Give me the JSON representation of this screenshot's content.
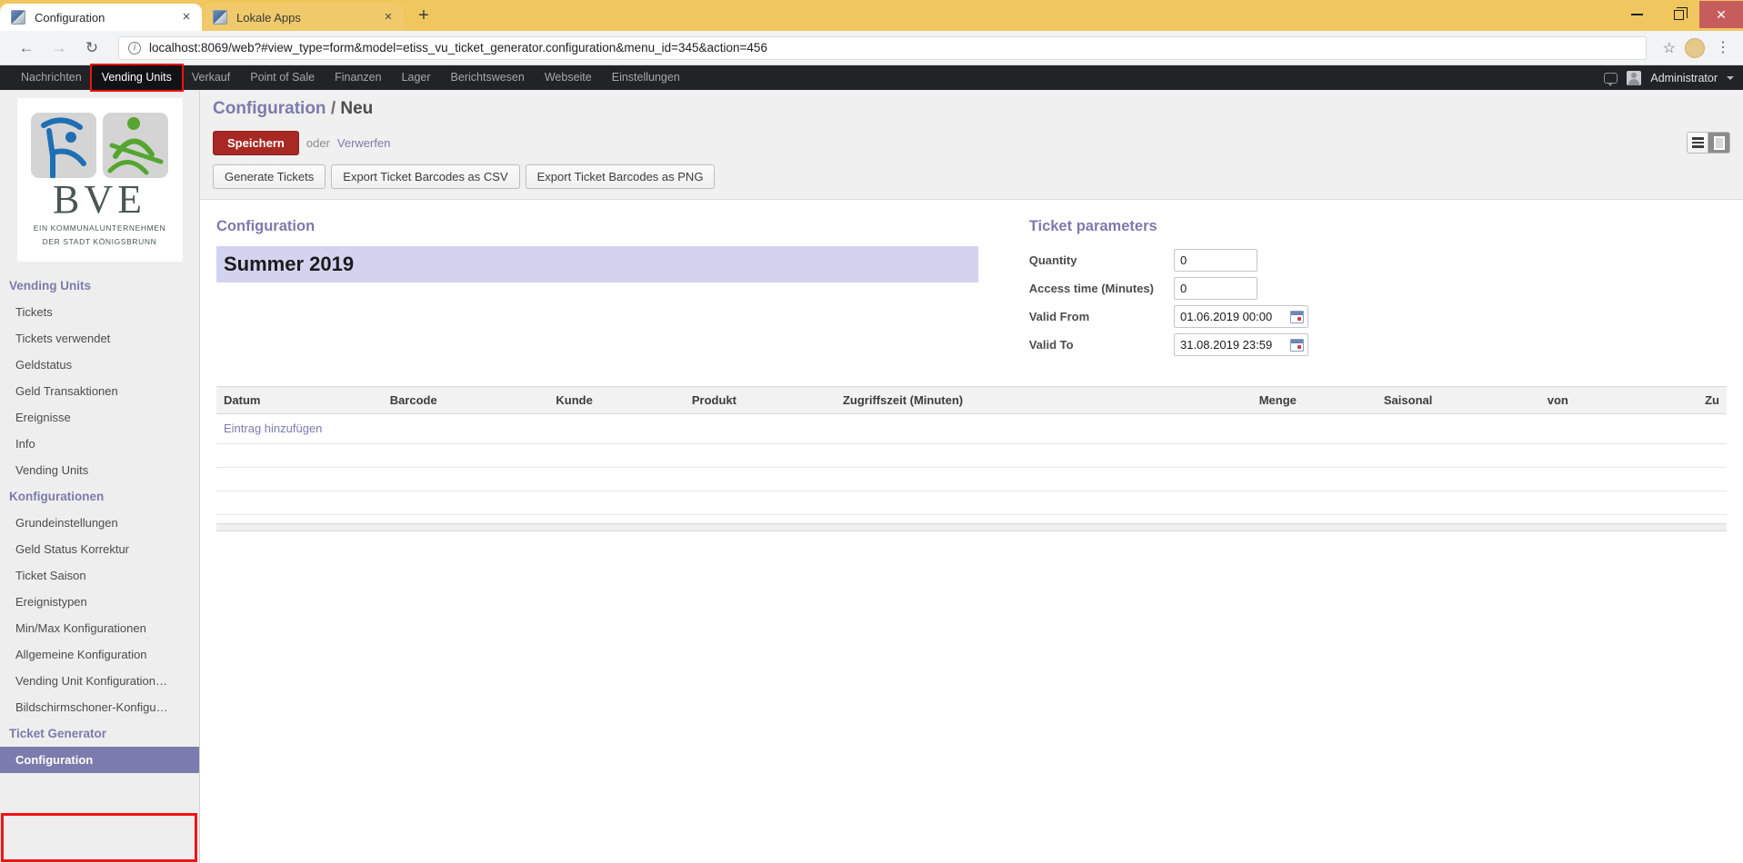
{
  "browser": {
    "tabs": [
      {
        "title": "Configuration",
        "active": true,
        "close_label": "×"
      },
      {
        "title": "Lokale Apps",
        "active": false,
        "close_label": "×"
      }
    ],
    "new_tab_label": "+",
    "window_controls": {
      "minimize": "",
      "maximize": "",
      "close": "✕"
    },
    "nav": {
      "back": "←",
      "forward": "→",
      "reload": "↻"
    },
    "address": "localhost:8069/web?#view_type=form&model=etiss_vu_ticket_generator.configuration&menu_id=345&action=456",
    "info_icon_label": "i",
    "bookmark_label": "☆",
    "menu_label": "⋮"
  },
  "topnav": {
    "items": [
      {
        "label": "Nachrichten",
        "active": false
      },
      {
        "label": "Vending Units",
        "active": true
      },
      {
        "label": "Verkauf",
        "active": false
      },
      {
        "label": "Point of Sale",
        "active": false
      },
      {
        "label": "Finanzen",
        "active": false
      },
      {
        "label": "Lager",
        "active": false
      },
      {
        "label": "Berichtswesen",
        "active": false
      },
      {
        "label": "Webseite",
        "active": false
      },
      {
        "label": "Einstellungen",
        "active": false
      }
    ],
    "user": "Administrator"
  },
  "sidebar": {
    "logo": {
      "wordmark": "BVE",
      "line1": "EIN KOMMUNALUNTERNEHMEN",
      "line2": "DER STADT KÖNIGSBRUNN"
    },
    "sections": [
      {
        "title": "Vending Units",
        "items": [
          {
            "label": "Tickets",
            "selected": false
          },
          {
            "label": "Tickets verwendet",
            "selected": false
          },
          {
            "label": "Geldstatus",
            "selected": false
          },
          {
            "label": "Geld Transaktionen",
            "selected": false
          },
          {
            "label": "Ereignisse",
            "selected": false
          },
          {
            "label": "Info",
            "selected": false
          },
          {
            "label": "Vending Units",
            "selected": false
          }
        ]
      },
      {
        "title": "Konfigurationen",
        "items": [
          {
            "label": "Grundeinstellungen",
            "selected": false
          },
          {
            "label": "Geld Status Korrektur",
            "selected": false
          },
          {
            "label": "Ticket Saison",
            "selected": false
          },
          {
            "label": "Ereignistypen",
            "selected": false
          },
          {
            "label": "Min/Max Konfigurationen",
            "selected": false
          },
          {
            "label": "Allgemeine Konfiguration",
            "selected": false
          },
          {
            "label": "Vending Unit Konfiguration…",
            "selected": false
          },
          {
            "label": "Bildschirmschoner-Konfigu…",
            "selected": false
          }
        ]
      },
      {
        "title": "Ticket Generator",
        "items": [
          {
            "label": "Configuration",
            "selected": true
          }
        ]
      }
    ]
  },
  "control_panel": {
    "breadcrumb_root": "Configuration",
    "breadcrumb_separator": "/",
    "breadcrumb_current": "Neu",
    "save_label": "Speichern",
    "or_label": "oder",
    "discard_label": "Verwerfen",
    "actions": [
      "Generate Tickets",
      "Export Ticket Barcodes as CSV",
      "Export Ticket Barcodes as PNG"
    ],
    "views": [
      {
        "name": "list-view",
        "active": false
      },
      {
        "name": "form-view",
        "active": true
      }
    ]
  },
  "form": {
    "left_section_title": "Configuration",
    "name_value": "Summer 2019",
    "right_section_title": "Ticket parameters",
    "fields": [
      {
        "label": "Quantity",
        "value": "0",
        "type": "number"
      },
      {
        "label": "Access time (Minutes)",
        "value": "0",
        "type": "number"
      },
      {
        "label": "Valid From",
        "value": "01.06.2019 00:00",
        "type": "datetime"
      },
      {
        "label": "Valid To",
        "value": "31.08.2019 23:59",
        "type": "datetime"
      }
    ]
  },
  "grid": {
    "columns": [
      {
        "label": "Datum",
        "align": "left"
      },
      {
        "label": "Barcode",
        "align": "left"
      },
      {
        "label": "Kunde",
        "align": "left"
      },
      {
        "label": "Produkt",
        "align": "left"
      },
      {
        "label": "Zugriffszeit (Minuten)",
        "align": "left"
      },
      {
        "label": "Menge",
        "align": "right"
      },
      {
        "label": "Saisonal",
        "align": "right"
      },
      {
        "label": "von",
        "align": "right"
      },
      {
        "label": "Zu",
        "align": "right"
      }
    ],
    "add_label": "Eintrag hinzufügen",
    "rows": [],
    "empty_row_count": 3
  },
  "colors": {
    "accent_purple": "#7c7bad",
    "save_red": "#a82824",
    "highlight_red": "#f41212",
    "tab_gold": "#efc75e",
    "field_lavender": "#d3d3f0"
  }
}
